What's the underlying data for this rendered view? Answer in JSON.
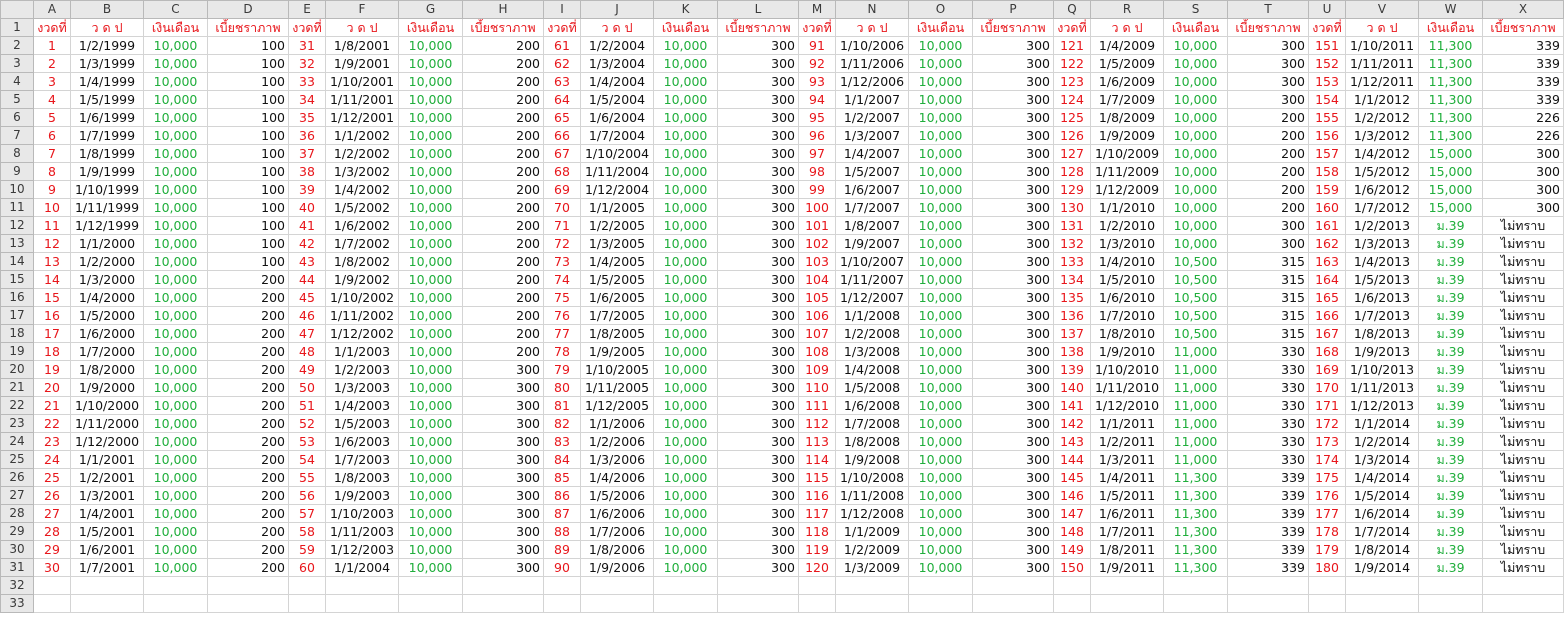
{
  "sheet": {
    "columns": [
      "A",
      "B",
      "C",
      "D",
      "E",
      "F",
      "G",
      "H",
      "I",
      "J",
      "K",
      "L",
      "M",
      "N",
      "O",
      "P",
      "Q",
      "R",
      "S",
      "T",
      "U",
      "V",
      "W",
      "X"
    ],
    "header": [
      "งวดที่",
      "ว ด ป",
      "เงินเดือน",
      "เบี้ยชราภาพ",
      "งวดที่",
      "ว ด ป",
      "เงินเดือน",
      "เบี้ยชราภาพ",
      "งวดที่",
      "ว ด ป",
      "เงินเดือน",
      "เบี้ยชราภาพ",
      "งวดที่",
      "ว ด ป",
      "เงินเดือน",
      "เบี้ยชราภาพ",
      "งวดที่",
      "ว ด ป",
      "เงินเดือน",
      "เบี้ยชราภาพ",
      "งวดที่",
      "ว ด ป",
      "เงินเดือน",
      "เบี้ยชราภาพ"
    ],
    "rows": [
      [
        "1",
        "1/2/1999",
        "10,000",
        "100",
        "31",
        "1/8/2001",
        "10,000",
        "200",
        "61",
        "1/2/2004",
        "10,000",
        "300",
        "91",
        "1/10/2006",
        "10,000",
        "300",
        "121",
        "1/4/2009",
        "10,000",
        "300",
        "151",
        "1/10/2011",
        "11,300",
        "339"
      ],
      [
        "2",
        "1/3/1999",
        "10,000",
        "100",
        "32",
        "1/9/2001",
        "10,000",
        "200",
        "62",
        "1/3/2004",
        "10,000",
        "300",
        "92",
        "1/11/2006",
        "10,000",
        "300",
        "122",
        "1/5/2009",
        "10,000",
        "300",
        "152",
        "1/11/2011",
        "11,300",
        "339"
      ],
      [
        "3",
        "1/4/1999",
        "10,000",
        "100",
        "33",
        "1/10/2001",
        "10,000",
        "200",
        "63",
        "1/4/2004",
        "10,000",
        "300",
        "93",
        "1/12/2006",
        "10,000",
        "300",
        "123",
        "1/6/2009",
        "10,000",
        "300",
        "153",
        "1/12/2011",
        "11,300",
        "339"
      ],
      [
        "4",
        "1/5/1999",
        "10,000",
        "100",
        "34",
        "1/11/2001",
        "10,000",
        "200",
        "64",
        "1/5/2004",
        "10,000",
        "300",
        "94",
        "1/1/2007",
        "10,000",
        "300",
        "124",
        "1/7/2009",
        "10,000",
        "300",
        "154",
        "1/1/2012",
        "11,300",
        "339"
      ],
      [
        "5",
        "1/6/1999",
        "10,000",
        "100",
        "35",
        "1/12/2001",
        "10,000",
        "200",
        "65",
        "1/6/2004",
        "10,000",
        "300",
        "95",
        "1/2/2007",
        "10,000",
        "300",
        "125",
        "1/8/2009",
        "10,000",
        "200",
        "155",
        "1/2/2012",
        "11,300",
        "226"
      ],
      [
        "6",
        "1/7/1999",
        "10,000",
        "100",
        "36",
        "1/1/2002",
        "10,000",
        "200",
        "66",
        "1/7/2004",
        "10,000",
        "300",
        "96",
        "1/3/2007",
        "10,000",
        "300",
        "126",
        "1/9/2009",
        "10,000",
        "200",
        "156",
        "1/3/2012",
        "11,300",
        "226"
      ],
      [
        "7",
        "1/8/1999",
        "10,000",
        "100",
        "37",
        "1/2/2002",
        "10,000",
        "200",
        "67",
        "1/10/2004",
        "10,000",
        "300",
        "97",
        "1/4/2007",
        "10,000",
        "300",
        "127",
        "1/10/2009",
        "10,000",
        "200",
        "157",
        "1/4/2012",
        "15,000",
        "300"
      ],
      [
        "8",
        "1/9/1999",
        "10,000",
        "100",
        "38",
        "1/3/2002",
        "10,000",
        "200",
        "68",
        "1/11/2004",
        "10,000",
        "300",
        "98",
        "1/5/2007",
        "10,000",
        "300",
        "128",
        "1/11/2009",
        "10,000",
        "200",
        "158",
        "1/5/2012",
        "15,000",
        "300"
      ],
      [
        "9",
        "1/10/1999",
        "10,000",
        "100",
        "39",
        "1/4/2002",
        "10,000",
        "200",
        "69",
        "1/12/2004",
        "10,000",
        "300",
        "99",
        "1/6/2007",
        "10,000",
        "300",
        "129",
        "1/12/2009",
        "10,000",
        "200",
        "159",
        "1/6/2012",
        "15,000",
        "300"
      ],
      [
        "10",
        "1/11/1999",
        "10,000",
        "100",
        "40",
        "1/5/2002",
        "10,000",
        "200",
        "70",
        "1/1/2005",
        "10,000",
        "300",
        "100",
        "1/7/2007",
        "10,000",
        "300",
        "130",
        "1/1/2010",
        "10,000",
        "200",
        "160",
        "1/7/2012",
        "15,000",
        "300"
      ],
      [
        "11",
        "1/12/1999",
        "10,000",
        "100",
        "41",
        "1/6/2002",
        "10,000",
        "200",
        "71",
        "1/2/2005",
        "10,000",
        "300",
        "101",
        "1/8/2007",
        "10,000",
        "300",
        "131",
        "1/2/2010",
        "10,000",
        "300",
        "161",
        "1/2/2013",
        "ม.39",
        "ไม่ทราบ"
      ],
      [
        "12",
        "1/1/2000",
        "10,000",
        "100",
        "42",
        "1/7/2002",
        "10,000",
        "200",
        "72",
        "1/3/2005",
        "10,000",
        "300",
        "102",
        "1/9/2007",
        "10,000",
        "300",
        "132",
        "1/3/2010",
        "10,000",
        "300",
        "162",
        "1/3/2013",
        "ม.39",
        "ไม่ทราบ"
      ],
      [
        "13",
        "1/2/2000",
        "10,000",
        "100",
        "43",
        "1/8/2002",
        "10,000",
        "200",
        "73",
        "1/4/2005",
        "10,000",
        "300",
        "103",
        "1/10/2007",
        "10,000",
        "300",
        "133",
        "1/4/2010",
        "10,500",
        "315",
        "163",
        "1/4/2013",
        "ม.39",
        "ไม่ทราบ"
      ],
      [
        "14",
        "1/3/2000",
        "10,000",
        "200",
        "44",
        "1/9/2002",
        "10,000",
        "200",
        "74",
        "1/5/2005",
        "10,000",
        "300",
        "104",
        "1/11/2007",
        "10,000",
        "300",
        "134",
        "1/5/2010",
        "10,500",
        "315",
        "164",
        "1/5/2013",
        "ม.39",
        "ไม่ทราบ"
      ],
      [
        "15",
        "1/4/2000",
        "10,000",
        "200",
        "45",
        "1/10/2002",
        "10,000",
        "200",
        "75",
        "1/6/2005",
        "10,000",
        "300",
        "105",
        "1/12/2007",
        "10,000",
        "300",
        "135",
        "1/6/2010",
        "10,500",
        "315",
        "165",
        "1/6/2013",
        "ม.39",
        "ไม่ทราบ"
      ],
      [
        "16",
        "1/5/2000",
        "10,000",
        "200",
        "46",
        "1/11/2002",
        "10,000",
        "200",
        "76",
        "1/7/2005",
        "10,000",
        "300",
        "106",
        "1/1/2008",
        "10,000",
        "300",
        "136",
        "1/7/2010",
        "10,500",
        "315",
        "166",
        "1/7/2013",
        "ม.39",
        "ไม่ทราบ"
      ],
      [
        "17",
        "1/6/2000",
        "10,000",
        "200",
        "47",
        "1/12/2002",
        "10,000",
        "200",
        "77",
        "1/8/2005",
        "10,000",
        "300",
        "107",
        "1/2/2008",
        "10,000",
        "300",
        "137",
        "1/8/2010",
        "10,500",
        "315",
        "167",
        "1/8/2013",
        "ม.39",
        "ไม่ทราบ"
      ],
      [
        "18",
        "1/7/2000",
        "10,000",
        "200",
        "48",
        "1/1/2003",
        "10,000",
        "200",
        "78",
        "1/9/2005",
        "10,000",
        "300",
        "108",
        "1/3/2008",
        "10,000",
        "300",
        "138",
        "1/9/2010",
        "11,000",
        "330",
        "168",
        "1/9/2013",
        "ม.39",
        "ไม่ทราบ"
      ],
      [
        "19",
        "1/8/2000",
        "10,000",
        "200",
        "49",
        "1/2/2003",
        "10,000",
        "300",
        "79",
        "1/10/2005",
        "10,000",
        "300",
        "109",
        "1/4/2008",
        "10,000",
        "300",
        "139",
        "1/10/2010",
        "11,000",
        "330",
        "169",
        "1/10/2013",
        "ม.39",
        "ไม่ทราบ"
      ],
      [
        "20",
        "1/9/2000",
        "10,000",
        "200",
        "50",
        "1/3/2003",
        "10,000",
        "300",
        "80",
        "1/11/2005",
        "10,000",
        "300",
        "110",
        "1/5/2008",
        "10,000",
        "300",
        "140",
        "1/11/2010",
        "11,000",
        "330",
        "170",
        "1/11/2013",
        "ม.39",
        "ไม่ทราบ"
      ],
      [
        "21",
        "1/10/2000",
        "10,000",
        "200",
        "51",
        "1/4/2003",
        "10,000",
        "300",
        "81",
        "1/12/2005",
        "10,000",
        "300",
        "111",
        "1/6/2008",
        "10,000",
        "300",
        "141",
        "1/12/2010",
        "11,000",
        "330",
        "171",
        "1/12/2013",
        "ม.39",
        "ไม่ทราบ"
      ],
      [
        "22",
        "1/11/2000",
        "10,000",
        "200",
        "52",
        "1/5/2003",
        "10,000",
        "300",
        "82",
        "1/1/2006",
        "10,000",
        "300",
        "112",
        "1/7/2008",
        "10,000",
        "300",
        "142",
        "1/1/2011",
        "11,000",
        "330",
        "172",
        "1/1/2014",
        "ม.39",
        "ไม่ทราบ"
      ],
      [
        "23",
        "1/12/2000",
        "10,000",
        "200",
        "53",
        "1/6/2003",
        "10,000",
        "300",
        "83",
        "1/2/2006",
        "10,000",
        "300",
        "113",
        "1/8/2008",
        "10,000",
        "300",
        "143",
        "1/2/2011",
        "11,000",
        "330",
        "173",
        "1/2/2014",
        "ม.39",
        "ไม่ทราบ"
      ],
      [
        "24",
        "1/1/2001",
        "10,000",
        "200",
        "54",
        "1/7/2003",
        "10,000",
        "300",
        "84",
        "1/3/2006",
        "10,000",
        "300",
        "114",
        "1/9/2008",
        "10,000",
        "300",
        "144",
        "1/3/2011",
        "11,000",
        "330",
        "174",
        "1/3/2014",
        "ม.39",
        "ไม่ทราบ"
      ],
      [
        "25",
        "1/2/2001",
        "10,000",
        "200",
        "55",
        "1/8/2003",
        "10,000",
        "300",
        "85",
        "1/4/2006",
        "10,000",
        "300",
        "115",
        "1/10/2008",
        "10,000",
        "300",
        "145",
        "1/4/2011",
        "11,300",
        "339",
        "175",
        "1/4/2014",
        "ม.39",
        "ไม่ทราบ"
      ],
      [
        "26",
        "1/3/2001",
        "10,000",
        "200",
        "56",
        "1/9/2003",
        "10,000",
        "300",
        "86",
        "1/5/2006",
        "10,000",
        "300",
        "116",
        "1/11/2008",
        "10,000",
        "300",
        "146",
        "1/5/2011",
        "11,300",
        "339",
        "176",
        "1/5/2014",
        "ม.39",
        "ไม่ทราบ"
      ],
      [
        "27",
        "1/4/2001",
        "10,000",
        "200",
        "57",
        "1/10/2003",
        "10,000",
        "300",
        "87",
        "1/6/2006",
        "10,000",
        "300",
        "117",
        "1/12/2008",
        "10,000",
        "300",
        "147",
        "1/6/2011",
        "11,300",
        "339",
        "177",
        "1/6/2014",
        "ม.39",
        "ไม่ทราบ"
      ],
      [
        "28",
        "1/5/2001",
        "10,000",
        "200",
        "58",
        "1/11/2003",
        "10,000",
        "300",
        "88",
        "1/7/2006",
        "10,000",
        "300",
        "118",
        "1/1/2009",
        "10,000",
        "300",
        "148",
        "1/7/2011",
        "11,300",
        "339",
        "178",
        "1/7/2014",
        "ม.39",
        "ไม่ทราบ"
      ],
      [
        "29",
        "1/6/2001",
        "10,000",
        "200",
        "59",
        "1/12/2003",
        "10,000",
        "300",
        "89",
        "1/8/2006",
        "10,000",
        "300",
        "119",
        "1/2/2009",
        "10,000",
        "300",
        "149",
        "1/8/2011",
        "11,300",
        "339",
        "179",
        "1/8/2014",
        "ม.39",
        "ไม่ทราบ"
      ],
      [
        "30",
        "1/7/2001",
        "10,000",
        "200",
        "60",
        "1/1/2004",
        "10,000",
        "300",
        "90",
        "1/9/2006",
        "10,000",
        "300",
        "120",
        "1/3/2009",
        "10,000",
        "300",
        "150",
        "1/9/2011",
        "11,300",
        "339",
        "180",
        "1/9/2014",
        "ม.39",
        "ไม่ทราบ"
      ]
    ],
    "row_numbers": [
      "1",
      "2",
      "3",
      "4",
      "5",
      "6",
      "7",
      "8",
      "9",
      "10",
      "11",
      "12",
      "13",
      "14",
      "15",
      "16",
      "17",
      "18",
      "19",
      "20",
      "21",
      "22",
      "23",
      "24",
      "25",
      "26",
      "27",
      "28",
      "29",
      "30",
      "31",
      "32",
      "33"
    ],
    "colors": {
      "installment": "#e8161b",
      "salary": "#1fae3b",
      "text": "#111111",
      "header_bg": "#e8e8e8"
    }
  }
}
